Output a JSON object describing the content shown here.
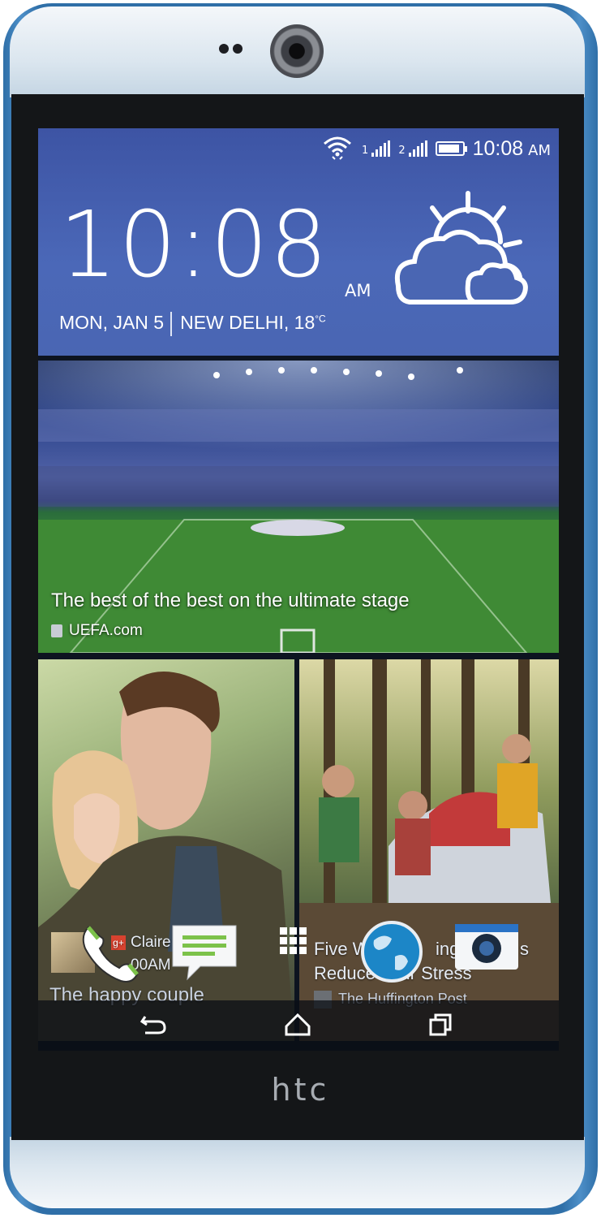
{
  "device": {
    "brand": "htc",
    "body_color": "#2f6fa8",
    "cap_color": "#dbe6ef"
  },
  "status_bar": {
    "time": "10:08",
    "ampm": "AM",
    "wifi_icon": "wifi-icon",
    "sim1_label": "1",
    "sim2_label": "2",
    "signal_icon": "signal-bars-icon",
    "battery_icon": "battery-icon",
    "battery_level": 0.9
  },
  "clock_widget": {
    "time": "10:08",
    "ampm": "AM",
    "date": "MON, JAN 5",
    "location_temp": "NEW DELHI, 18",
    "unit": "°C",
    "weather_icon": "partly-cloudy-icon"
  },
  "news_tile": {
    "title": "The best of the best on the ultimate stage",
    "source": "UEFA.com",
    "source_icon": "uefa-logo-icon"
  },
  "tiles": [
    {
      "contact": "Claire",
      "time": "00AM",
      "caption": "The happy couple"
    },
    {
      "headline_line1": "Five W",
      "headline_line1_end": "ing",
      "headline_line1_tail": "s",
      "headline_line2": "Reduce Your Stress",
      "source": "The Huffington Post",
      "source_icon": "huffpost-icon"
    }
  ],
  "dock": [
    {
      "name": "phone",
      "icon": "phone-icon"
    },
    {
      "name": "messages",
      "icon": "messages-icon"
    },
    {
      "name": "apps",
      "icon": "app-drawer-icon"
    },
    {
      "name": "browser",
      "icon": "globe-icon"
    },
    {
      "name": "camera",
      "icon": "camera-icon"
    }
  ],
  "nav": [
    {
      "name": "back",
      "icon": "back-icon"
    },
    {
      "name": "home",
      "icon": "home-icon"
    },
    {
      "name": "recents",
      "icon": "recents-icon"
    }
  ]
}
